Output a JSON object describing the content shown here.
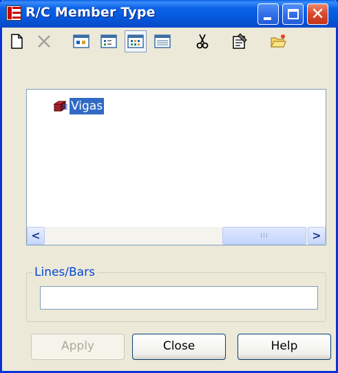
{
  "window": {
    "title": "R/C Member Type"
  },
  "toolbar": {
    "tools": [
      {
        "icon": "new-document-icon"
      },
      {
        "icon": "delete-icon"
      },
      {
        "icon": "large-icons-view-icon"
      },
      {
        "icon": "small-icons-view-icon"
      },
      {
        "icon": "list-view-icon",
        "pressed": true
      },
      {
        "icon": "details-view-icon"
      },
      {
        "icon": "cut-icon"
      },
      {
        "icon": "properties-icon"
      },
      {
        "icon": "open-folder-icon"
      }
    ]
  },
  "tree": {
    "items": [
      {
        "label": "Vigas",
        "icon": "member-type-icon",
        "selected": true
      }
    ],
    "scroll_grip": "III"
  },
  "lines_bars": {
    "label": "Lines/Bars",
    "value": ""
  },
  "buttons": {
    "apply": "Apply",
    "close": "Close",
    "help": "Help"
  },
  "colors": {
    "titlebar": "#0a5fe6",
    "selection": "#316ac5",
    "group_label": "#0046d5"
  }
}
